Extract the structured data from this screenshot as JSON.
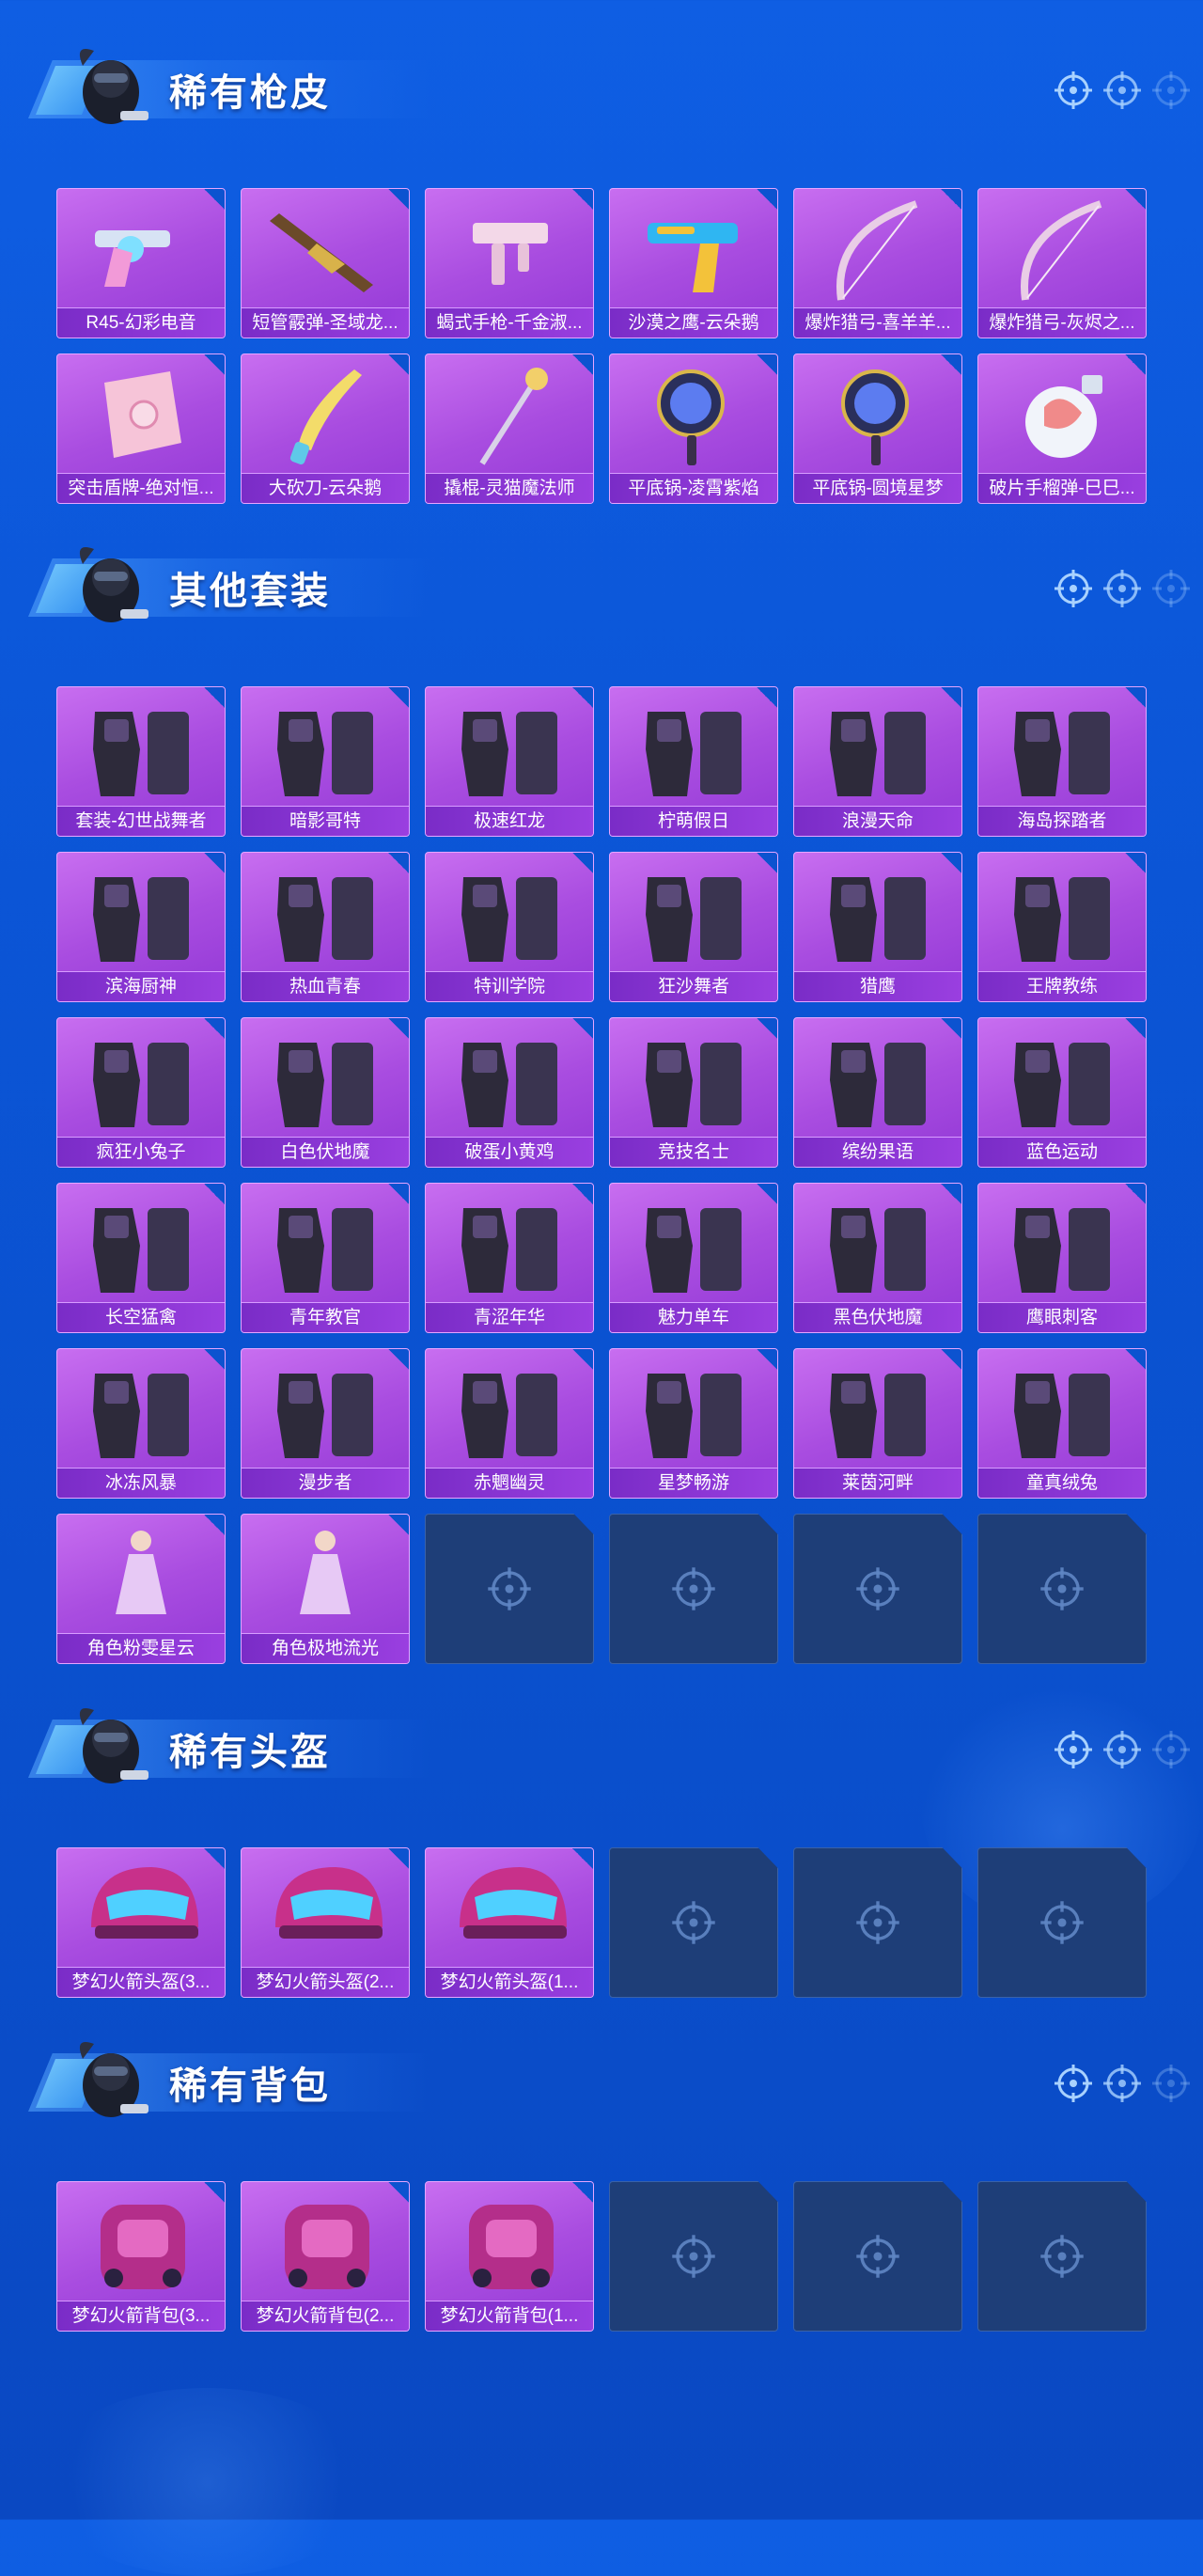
{
  "sections": [
    {
      "title": "稀有枪皮",
      "items": [
        {
          "label": "R45-幻彩电音",
          "icon": "revolver-icon"
        },
        {
          "label": "短管霰弹-圣域龙...",
          "icon": "shotgun-icon"
        },
        {
          "label": "蝎式手枪-千金淑...",
          "icon": "smg-icon"
        },
        {
          "label": "沙漠之鹰-云朵鹅",
          "icon": "pistol-icon"
        },
        {
          "label": "爆炸猎弓-喜羊羊...",
          "icon": "bow-icon"
        },
        {
          "label": "爆炸猎弓-灰烬之...",
          "icon": "bow-icon"
        },
        {
          "label": "突击盾牌-绝对恒...",
          "icon": "shield-icon"
        },
        {
          "label": "大砍刀-云朵鹅",
          "icon": "machete-icon"
        },
        {
          "label": "撬棍-灵猫魔法师",
          "icon": "staff-icon"
        },
        {
          "label": "平底锅-凌霄紫焰",
          "icon": "pan-icon"
        },
        {
          "label": "平底锅-圆境星梦",
          "icon": "pan-icon"
        },
        {
          "label": "破片手榴弹-巳巳...",
          "icon": "grenade-icon"
        }
      ]
    },
    {
      "title": "其他套装",
      "items": [
        {
          "label": "套装-幻世战舞者",
          "icon": "outfit-icon"
        },
        {
          "label": "暗影哥特",
          "icon": "outfit-icon"
        },
        {
          "label": "极速红龙",
          "icon": "outfit-icon"
        },
        {
          "label": "柠萌假日",
          "icon": "outfit-icon"
        },
        {
          "label": "浪漫天命",
          "icon": "outfit-icon"
        },
        {
          "label": "海岛探踏者",
          "icon": "outfit-icon"
        },
        {
          "label": "滨海厨神",
          "icon": "outfit-icon"
        },
        {
          "label": "热血青春",
          "icon": "outfit-icon"
        },
        {
          "label": "特训学院",
          "icon": "outfit-icon"
        },
        {
          "label": "狂沙舞者",
          "icon": "outfit-icon"
        },
        {
          "label": "猎鹰",
          "icon": "outfit-icon"
        },
        {
          "label": "王牌教练",
          "icon": "outfit-icon"
        },
        {
          "label": "疯狂小兔子",
          "icon": "outfit-icon"
        },
        {
          "label": "白色伏地魔",
          "icon": "outfit-icon"
        },
        {
          "label": "破蛋小黄鸡",
          "icon": "outfit-icon"
        },
        {
          "label": "竞技名士",
          "icon": "outfit-icon"
        },
        {
          "label": "缤纷果语",
          "icon": "outfit-icon"
        },
        {
          "label": "蓝色运动",
          "icon": "outfit-icon"
        },
        {
          "label": "长空猛禽",
          "icon": "outfit-icon"
        },
        {
          "label": "青年教官",
          "icon": "outfit-icon"
        },
        {
          "label": "青涩年华",
          "icon": "outfit-icon"
        },
        {
          "label": "魅力单车",
          "icon": "outfit-icon"
        },
        {
          "label": "黑色伏地魔",
          "icon": "outfit-icon"
        },
        {
          "label": "鹰眼刺客",
          "icon": "outfit-icon"
        },
        {
          "label": "冰冻风暴",
          "icon": "outfit-icon"
        },
        {
          "label": "漫步者",
          "icon": "outfit-icon"
        },
        {
          "label": "赤魍幽灵",
          "icon": "outfit-icon"
        },
        {
          "label": "星梦畅游",
          "icon": "outfit-icon"
        },
        {
          "label": "莱茵河畔",
          "icon": "outfit-icon"
        },
        {
          "label": "童真绒兔",
          "icon": "outfit-icon"
        },
        {
          "label": "角色粉雯星云",
          "icon": "character-icon"
        },
        {
          "label": "角色极地流光",
          "icon": "character-icon"
        }
      ],
      "empty_slots": 4
    },
    {
      "title": "稀有头盔",
      "items": [
        {
          "label": "梦幻火箭头盔(3...",
          "icon": "helmet-icon"
        },
        {
          "label": "梦幻火箭头盔(2...",
          "icon": "helmet-icon"
        },
        {
          "label": "梦幻火箭头盔(1...",
          "icon": "helmet-icon"
        }
      ],
      "empty_slots": 3
    },
    {
      "title": "稀有背包",
      "items": [
        {
          "label": "梦幻火箭背包(3...",
          "icon": "backpack-icon"
        },
        {
          "label": "梦幻火箭背包(2...",
          "icon": "backpack-icon"
        },
        {
          "label": "梦幻火箭背包(1...",
          "icon": "backpack-icon"
        }
      ],
      "empty_slots": 3
    }
  ],
  "colors": {
    "background": "#0c55d6",
    "card_fill": "#a94de0",
    "card_label_bar": "#8a34d6",
    "empty_slot": "#1e3e78",
    "title_text": "#ffffff"
  },
  "header_icons": [
    "crosshair-icon",
    "crosshair-icon",
    "crosshair-icon"
  ],
  "empty_slot_icon": "crosshair-icon"
}
